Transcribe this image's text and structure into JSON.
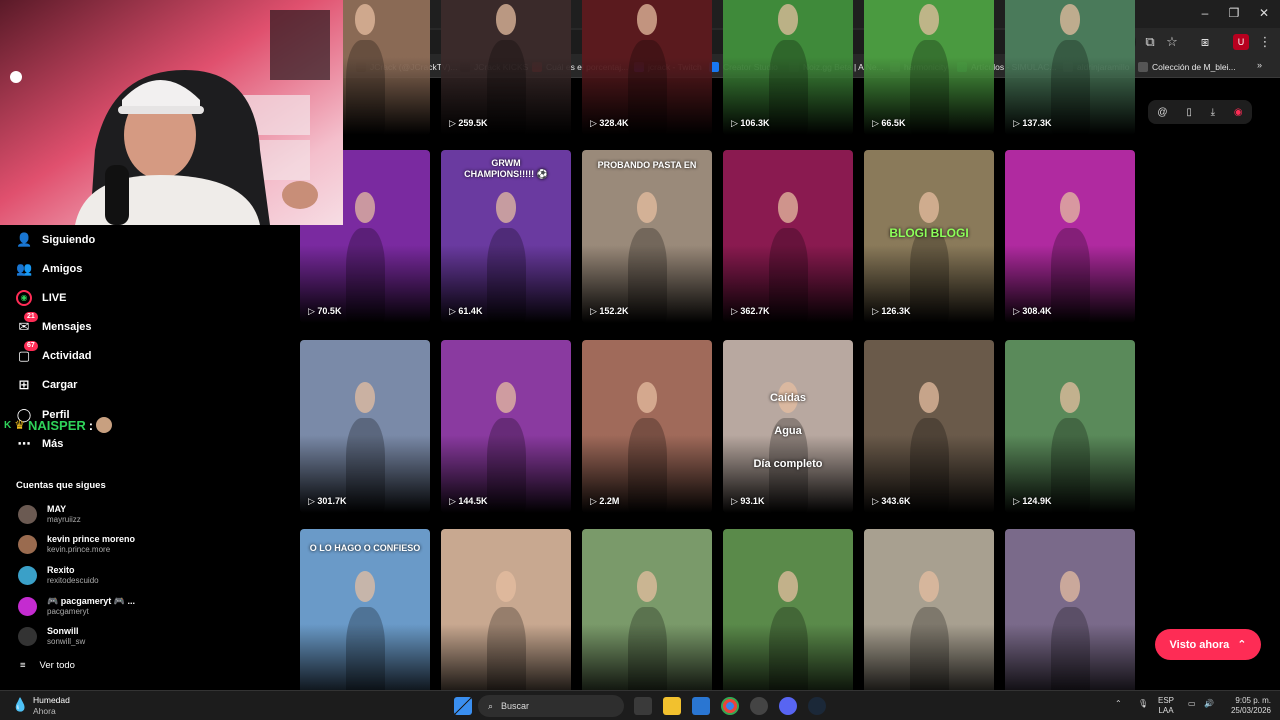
{
  "browser": {
    "bookmarks": [
      {
        "label": "JCrack (@JCrackTV)...",
        "icon": "x-icon",
        "color": "#000000"
      },
      {
        "label": "JCrack KICKS",
        "icon": "tiktok-icon",
        "color": "#111111"
      },
      {
        "label": "Cuál es el porcentaj...",
        "icon": "s-icon",
        "color": "#e0242f"
      },
      {
        "label": "jcrack - Twitch",
        "icon": "twitch-icon",
        "color": "#9146ff"
      },
      {
        "label": "Creator Studio",
        "icon": "facebook-icon",
        "color": "#1877f2"
      },
      {
        "label": "Noiz.gg Beta | A Ne...",
        "icon": "noiz-icon",
        "color": "#444444"
      },
      {
        "label": "harmonicity",
        "icon": "globe-icon",
        "color": "#555555"
      },
      {
        "label": "Artículos - SIMULAC...",
        "icon": "drive-icon",
        "color": "#34a853"
      },
      {
        "label": "aldrinjaramillo",
        "icon": "globe-icon",
        "color": "#555555"
      },
      {
        "label": "Colección de M_blei...",
        "icon": "globe-icon",
        "color": "#555555"
      }
    ],
    "bookmarks_more": "»"
  },
  "sidebar": {
    "items": [
      {
        "label": "Siguiendo",
        "icon": "following-icon"
      },
      {
        "label": "Amigos",
        "icon": "friends-icon"
      },
      {
        "label": "LIVE",
        "icon": "live-icon"
      },
      {
        "label": "Mensajes",
        "icon": "messages-icon",
        "badge": "21"
      },
      {
        "label": "Actividad",
        "icon": "activity-icon",
        "badge": "67"
      },
      {
        "label": "Cargar",
        "icon": "upload-icon"
      },
      {
        "label": "Perfil",
        "icon": "profile-icon"
      },
      {
        "label": "Más",
        "icon": "more-icon"
      }
    ],
    "following_heading": "Cuentas que sigues",
    "following": [
      {
        "name": "MAY",
        "handle": "mayruiizz",
        "color": "#6b5a52"
      },
      {
        "name": "kevin prince moreno",
        "handle": "kevin.prince.more",
        "color": "#9a6b4f"
      },
      {
        "name": "Rexito",
        "handle": "rexitodescuido",
        "color": "#3aa0c8"
      },
      {
        "name": "🎮 pacgameryt 🎮 ...",
        "handle": "pacgameryt",
        "color": "#c42bd0"
      },
      {
        "name": "Sonwill",
        "handle": "sonwill_sw",
        "color": "#333333"
      }
    ],
    "see_all": "Ver todo"
  },
  "overlay_chat": {
    "user": "NAISPER",
    "sep": ":"
  },
  "grid": {
    "rows": [
      [
        {
          "views": "",
          "bg": "#8a6a55"
        },
        {
          "views": "259.5K",
          "bg": "#3a2a2a"
        },
        {
          "views": "328.4K",
          "bg": "#5a1a1e"
        },
        {
          "views": "106.3K",
          "bg": "#3f8a3a"
        },
        {
          "views": "66.5K",
          "bg": "#4a9a40"
        },
        {
          "views": "137.3K",
          "bg": "#4a7a5a"
        }
      ],
      [
        {
          "views": "70.5K",
          "bg": "#7a2aa0",
          "caption": ""
        },
        {
          "views": "61.4K",
          "bg": "#6a3aa0",
          "caption": "GRWM\nCHAMPIONS!!!!! ⚽"
        },
        {
          "views": "152.2K",
          "bg": "#9a8a7a",
          "caption": "PROBANDO PASTA EN"
        },
        {
          "views": "362.7K",
          "bg": "#8a1a50",
          "caption": ""
        },
        {
          "views": "126.3K",
          "bg": "#8a7a5a",
          "caption": "BLOGI BLOGI"
        },
        {
          "views": "308.4K",
          "bg": "#b02aa0",
          "caption": ""
        }
      ],
      [
        {
          "views": "301.7K",
          "bg": "#7a8aa8",
          "caption": ""
        },
        {
          "views": "144.5K",
          "bg": "#8a3aa0",
          "caption": ""
        },
        {
          "views": "2.2M",
          "bg": "#a06a5a",
          "caption": ""
        },
        {
          "views": "93.1K",
          "bg": "#b8a8a0",
          "caption": "Caídas\nAgua\nDía completo"
        },
        {
          "views": "343.6K",
          "bg": "#6a5a4a",
          "caption": ""
        },
        {
          "views": "124.9K",
          "bg": "#5a8a5a",
          "caption": ""
        }
      ],
      [
        {
          "views": "",
          "bg": "#6a9ac8",
          "caption": "O LO HAGO O CONFIESO"
        },
        {
          "views": "",
          "bg": "#c8a890",
          "caption": ""
        },
        {
          "views": "",
          "bg": "#7a9a6a",
          "caption": ""
        },
        {
          "views": "",
          "bg": "#5a8a4a",
          "caption": ""
        },
        {
          "views": "",
          "bg": "#a8a090",
          "caption": ""
        },
        {
          "views": "",
          "bg": "#7a6a8a",
          "caption": ""
        }
      ]
    ]
  },
  "visto_ahora": {
    "label": "Visto ahora",
    "icon": "chevrons-up-icon"
  },
  "taskbar": {
    "weather_title": "Humedad",
    "weather_sub": "Ahora",
    "search_placeholder": "Buscar",
    "lang_top": "ESP",
    "lang_bottom": "LAA",
    "time": "9:05 p. m.",
    "date": "25/03/2026"
  }
}
